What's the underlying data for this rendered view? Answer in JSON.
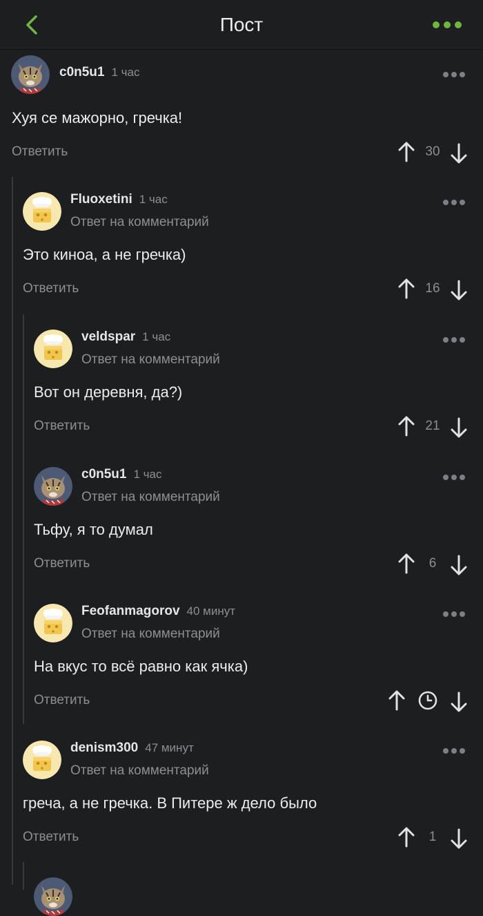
{
  "header": {
    "title": "Пост",
    "accent_color": "#6fb83e"
  },
  "comments": [
    {
      "username": "c0n5u1",
      "time": "1 час",
      "reply_to": "",
      "text": "Хуя се мажорно, гречка!",
      "answer": "Ответить",
      "rating": "30",
      "avatar": "cat-avatar"
    },
    {
      "username": "Fluoxetini",
      "time": "1 час",
      "reply_to": "Ответ на комментарий",
      "text": "Это киноа, а не гречка)",
      "answer": "Ответить",
      "rating": "16",
      "avatar": "default-cheese-avatar"
    },
    {
      "username": "veldspar",
      "time": "1 час",
      "reply_to": "Ответ на комментарий",
      "text": "Вот он деревня, да?)",
      "answer": "Ответить",
      "rating": "21",
      "avatar": "default-cheese-avatar"
    },
    {
      "username": "c0n5u1",
      "time": "1 час",
      "reply_to": "Ответ на комментарий",
      "text": "Тьфу, я то думал",
      "answer": "Ответить",
      "rating": "6",
      "avatar": "cat-avatar"
    },
    {
      "username": "Feofanmagorov",
      "time": "40 минут",
      "reply_to": "Ответ на комментарий",
      "text": "На вкус то всё равно как ячка)",
      "answer": "Ответить",
      "rating": "",
      "rating_pending": true,
      "avatar": "default-cheese-avatar"
    },
    {
      "username": "denism300",
      "time": "47 минут",
      "reply_to": "Ответ на комментарий",
      "text": "греча, а не гречка. В Питере ж дело было",
      "answer": "Ответить",
      "rating": "1",
      "avatar": "default-cheese-avatar"
    }
  ]
}
